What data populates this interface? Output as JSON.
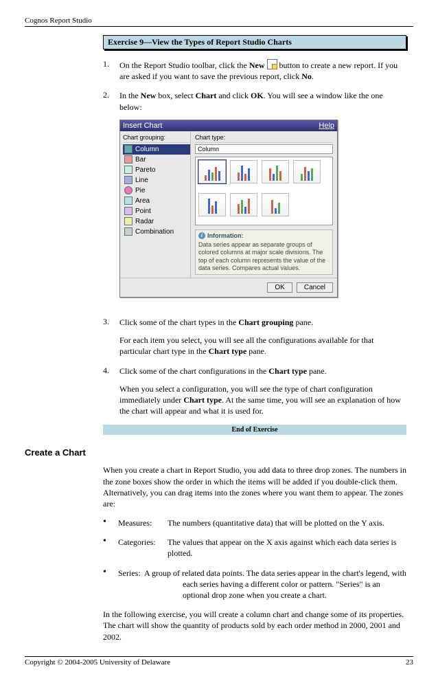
{
  "header": {
    "title": "Cognos Report Studio"
  },
  "exercise": {
    "title": "Exercise 9—View the Types of Report Studio Charts",
    "step1_a": "On the Report Studio toolbar, click the ",
    "step1_new": "New",
    "step1_b": " button to create a new report. If you are asked if you want to save the previous report, click ",
    "step1_no": "No",
    "step1_c": ".",
    "step2_a": "In the ",
    "step2_new": "New",
    "step2_b": " box, select ",
    "step2_chart": "Chart",
    "step2_c": " and click ",
    "step2_ok": "OK",
    "step2_d": ". You will see a window like the one below:",
    "step3_a": "Click some of the chart types in the ",
    "step3_bold": "Chart grouping",
    "step3_b": " pane.",
    "step3_expl": "For each item you select, you will see all the configurations available for that particular chart type in the ",
    "step3_expl_bold": "Chart type",
    "step3_expl_b": " pane.",
    "step4_a": "Click some of the chart configurations in the ",
    "step4_bold": "Chart type",
    "step4_b": " pane.",
    "step4_expl_a": "When you select a configuration, you will see the type of chart configuration immediately under ",
    "step4_expl_bold": "Chart type",
    "step4_expl_b": ". At the same time, you will see an explanation of how the chart will appear and what it is used for.",
    "end": "End of Exercise"
  },
  "dialog": {
    "title": "Insert Chart",
    "help": "Help",
    "left_header": "Chart grouping:",
    "groups": [
      "Column",
      "Bar",
      "Pareto",
      "Line",
      "Pie",
      "Area",
      "Point",
      "Radar",
      "Combination"
    ],
    "right_header": "Chart type:",
    "selected_type": "Column",
    "info_title": "Information:",
    "info_text": "Data series appear as separate groups of colored columns at major scale divisions. The top of each column represents the value of the data series. Compares actual values.",
    "ok": "OK",
    "cancel": "Cancel"
  },
  "section": {
    "heading": "Create a Chart",
    "intro": "When you create a chart in Report Studio, you add data to three drop zones. The numbers in the zone boxes show the order in which the items will be added if you double-click them. Alternatively, you can drag items into the zones where you want them to appear. The zones are:",
    "measures_label": "Measures:",
    "measures_def": "The numbers (quantitative data) that will be plotted on the Y axis.",
    "categories_label": "Categories:",
    "categories_def": "The values that appear on the X axis against which each data series is plotted.",
    "series_label": "Series:",
    "series_def": "A group of related data points. The data series appear in the chart's legend, with",
    "series_def2": "each series having a different color or pattern. \"Series\" is an optional drop zone when you create a chart.",
    "closing": "In the following exercise, you will create a column chart and change some of its properties. The chart will show the quantity of products sold by each order method in 2000, 2001 and 2002."
  },
  "footer": {
    "copyright": "Copyright © 2004-2005 University of Delaware",
    "page": "23"
  }
}
